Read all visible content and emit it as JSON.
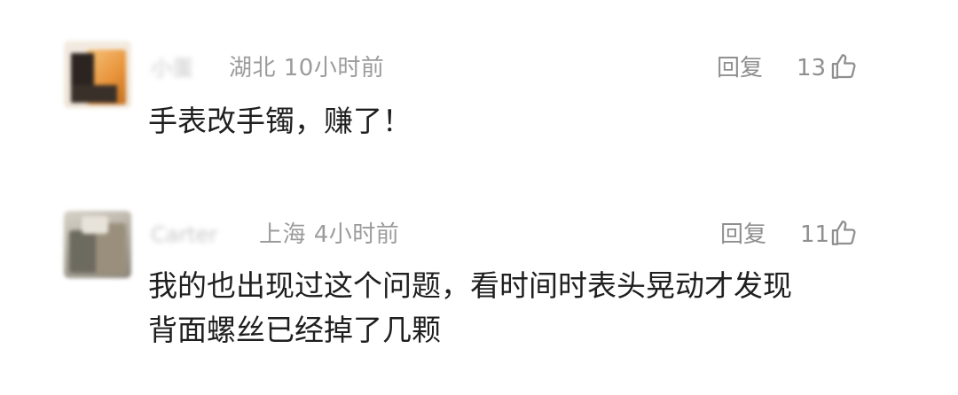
{
  "comments": [
    {
      "username": "小蛋",
      "location_time": "湖北 10小时前",
      "reply_label": "回复",
      "likes": "13",
      "text_lines": [
        "手表改手镯，赚了！"
      ]
    },
    {
      "username": "Carter",
      "location_time": "上海 4小时前",
      "reply_label": "回复",
      "likes": "11",
      "text_lines": [
        "我的也出现过这个问题，看时间时表头晃动才发现",
        "背面螺丝已经掉了几颗"
      ]
    }
  ],
  "icons": {
    "like": "thumbs-up-outline-icon"
  },
  "colors": {
    "meta_text": "#9b9b9b",
    "body_text": "#1f1f1f",
    "background": "#ffffff"
  }
}
